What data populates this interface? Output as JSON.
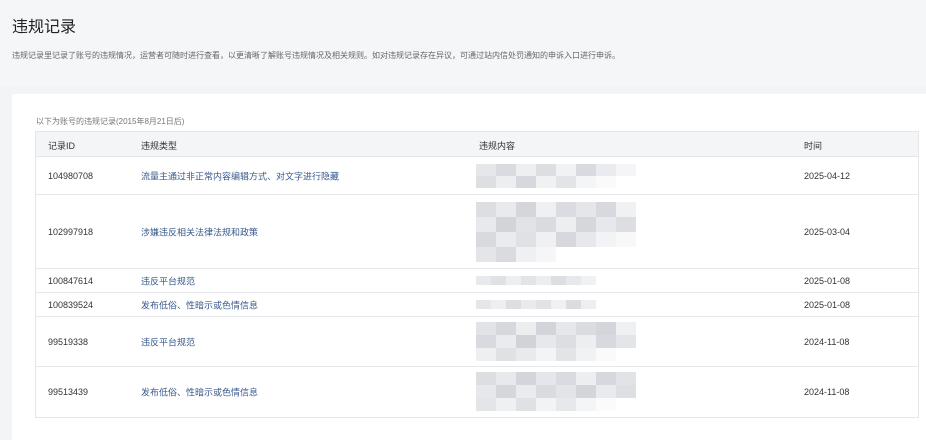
{
  "page": {
    "title": "违规记录",
    "description": "违规记录里记录了账号的违规情况，运营者可随时进行查看，以更清晰了解账号违规情况及相关规则。如对违规记录存在异议，可通过站内信处罚通知的申诉入口进行申诉。"
  },
  "records": {
    "caption": "以下为账号的违规记录(2015年8月21日后)",
    "columns": {
      "id": "记录ID",
      "type": "违规类型",
      "content": "违规内容",
      "time": "时间"
    },
    "rows": [
      {
        "id": "104980708",
        "type": "流量主通过非正常内容编辑方式、对文字进行隐藏",
        "content": "[已打码]",
        "time": "2025-04-12"
      },
      {
        "id": "102997918",
        "type": "涉嫌违反相关法律法规和政策",
        "content": "[已打码]",
        "time": "2025-03-04"
      },
      {
        "id": "100847614",
        "type": "违反平台规范",
        "content": "[已打码]",
        "time": "2025-01-08"
      },
      {
        "id": "100839524",
        "type": "发布低俗、性暗示或色情信息",
        "content": "[已打码]",
        "time": "2025-01-08"
      },
      {
        "id": "99519338",
        "type": "违反平台规范",
        "content": "[已打码]",
        "time": "2024-11-08"
      },
      {
        "id": "99513439",
        "type": "发布低俗、性暗示或色情信息",
        "content": "[已打码]",
        "time": "2024-11-08"
      }
    ]
  },
  "colors": {
    "link": "#3a5a8c",
    "header_bg": "#f4f5f7",
    "border": "#e4e6ea",
    "page_bg": "#f3f4f6"
  }
}
